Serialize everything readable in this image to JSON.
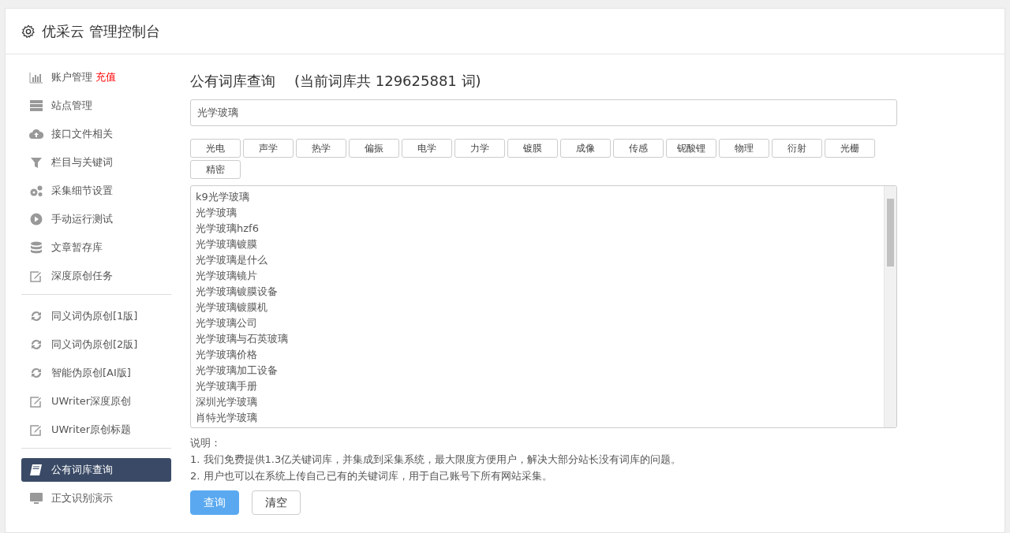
{
  "header": {
    "title": "优采云 管理控制台"
  },
  "sidebar": {
    "groups": [
      {
        "items": [
          {
            "label": "账户管理",
            "badge": "充值",
            "kind": "chart",
            "selected": false
          },
          {
            "label": "站点管理",
            "kind": "server",
            "selected": false
          },
          {
            "label": "接口文件相关",
            "kind": "cloud",
            "selected": false
          },
          {
            "label": "栏目与关键词",
            "kind": "filter",
            "selected": false
          },
          {
            "label": "采集细节设置",
            "kind": "gears",
            "selected": false
          },
          {
            "label": "手动运行测试",
            "kind": "play",
            "selected": false
          },
          {
            "label": "文章暂存库",
            "kind": "database",
            "selected": false
          },
          {
            "label": "深度原创任务",
            "kind": "edit",
            "selected": false
          }
        ]
      },
      {
        "items": [
          {
            "label": "同义词伪原创[1版]",
            "kind": "refresh",
            "selected": false
          },
          {
            "label": "同义词伪原创[2版]",
            "kind": "refresh",
            "selected": false
          },
          {
            "label": "智能伪原创[AI版]",
            "kind": "refresh",
            "selected": false
          },
          {
            "label": "UWriter深度原创",
            "kind": "edit",
            "selected": false
          },
          {
            "label": "UWriter原创标题",
            "kind": "edit",
            "selected": false
          }
        ]
      },
      {
        "items": [
          {
            "label": "公有词库查询",
            "kind": "book",
            "selected": true
          },
          {
            "label": "正文识别演示",
            "kind": "monitor",
            "selected": false
          }
        ]
      }
    ]
  },
  "main": {
    "title": "公有词库查询",
    "count_text": "(当前词库共 129625881 词)",
    "search": {
      "value": "光学玻璃"
    },
    "tags": [
      "光电",
      "声学",
      "热学",
      "偏振",
      "电学",
      "力学",
      "镀膜",
      "成像",
      "传感",
      "铌酸锂",
      "物理",
      "衍射",
      "光栅",
      "精密"
    ],
    "results": [
      "k9光学玻璃",
      "光学玻璃",
      "光学玻璃hzf6",
      "光学玻璃镀膜",
      "光学玻璃是什么",
      "光学玻璃镜片",
      "光学玻璃镀膜设备",
      "光学玻璃镀膜机",
      "光学玻璃公司",
      "光学玻璃与石英玻璃",
      "光学玻璃价格",
      "光学玻璃加工设备",
      "光学玻璃手册",
      "深圳光学玻璃",
      "肖特光学玻璃"
    ],
    "notes_title": "说明：",
    "notes": [
      "1. 我们免费提供1.3亿关键词库，并集成到采集系统，最大限度方便用户，解决大部分站长没有词库的问题。",
      "2. 用户也可以在系统上传自己已有的关键词库，用于自己账号下所有网站采集。"
    ],
    "buttons": [
      {
        "label": "查询",
        "kind": "primary"
      },
      {
        "label": "清空",
        "kind": "secondary"
      }
    ]
  }
}
